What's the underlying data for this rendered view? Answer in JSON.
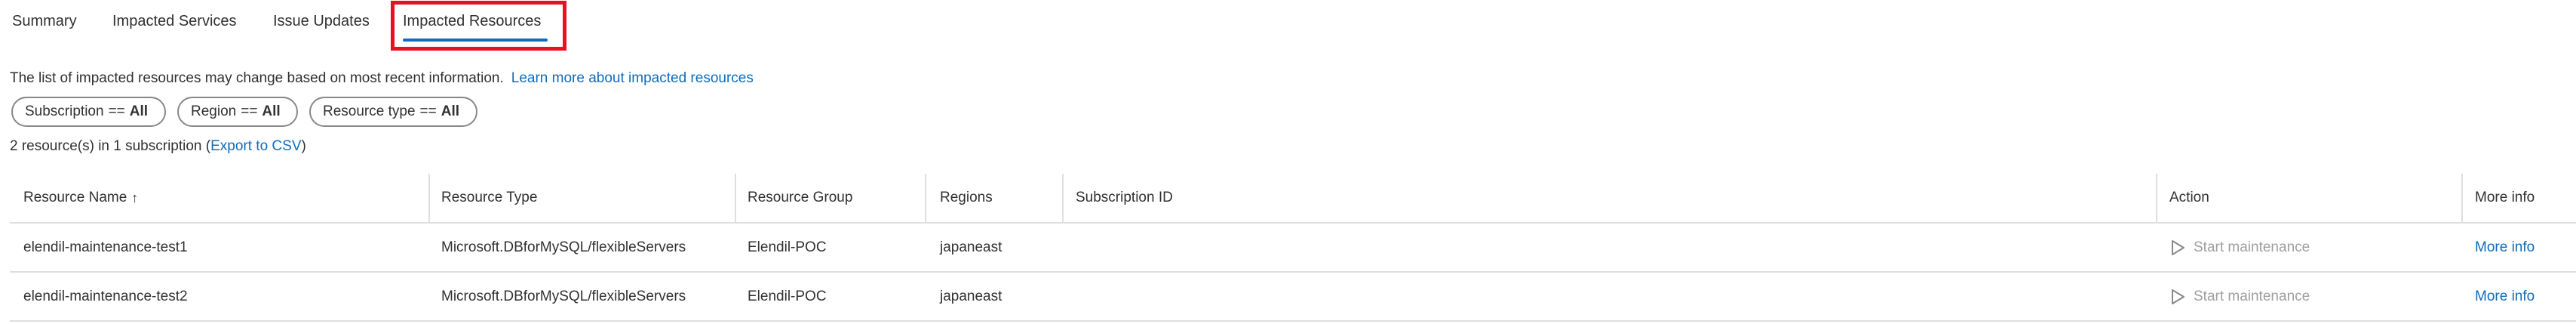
{
  "tabs": [
    {
      "label": "Summary"
    },
    {
      "label": "Impacted Services"
    },
    {
      "label": "Issue Updates"
    },
    {
      "label": "Impacted Resources"
    }
  ],
  "active_tab": "Impacted Resources",
  "colors": {
    "accent": "#0f6cbd",
    "highlight_box": "#e81123",
    "text": "#323130",
    "disabled": "#a19f9d",
    "divider": "#e1dfdd"
  },
  "info": {
    "text": "The list of impacted resources may change based on most recent information.",
    "link": "Learn more about impacted resources"
  },
  "filters": [
    {
      "key": "Subscription",
      "op": "==",
      "value": "All"
    },
    {
      "key": "Region",
      "op": "==",
      "value": "All"
    },
    {
      "key": "Resource type",
      "op": "==",
      "value": "All"
    }
  ],
  "summary": {
    "prefix": "2 resource(s) in 1 subscription (",
    "export_link": "Export to CSV",
    "suffix": ")"
  },
  "table": {
    "columns": {
      "name": "Resource Name",
      "name_sort": "↑",
      "type": "Resource Type",
      "group": "Resource Group",
      "regions": "Regions",
      "subscription": "Subscription ID",
      "action": "Action",
      "more": "More info"
    },
    "rows": [
      {
        "name": "elendil-maintenance-test1",
        "type": "Microsoft.DBforMySQL/flexibleServers",
        "group": "Elendil-POC",
        "region": "japaneast",
        "subscription": "",
        "action": "Start maintenance",
        "action_icon": "play-icon",
        "more": "More info"
      },
      {
        "name": "elendil-maintenance-test2",
        "type": "Microsoft.DBforMySQL/flexibleServers",
        "group": "Elendil-POC",
        "region": "japaneast",
        "subscription": "",
        "action": "Start maintenance",
        "action_icon": "play-icon",
        "more": "More info"
      }
    ]
  }
}
